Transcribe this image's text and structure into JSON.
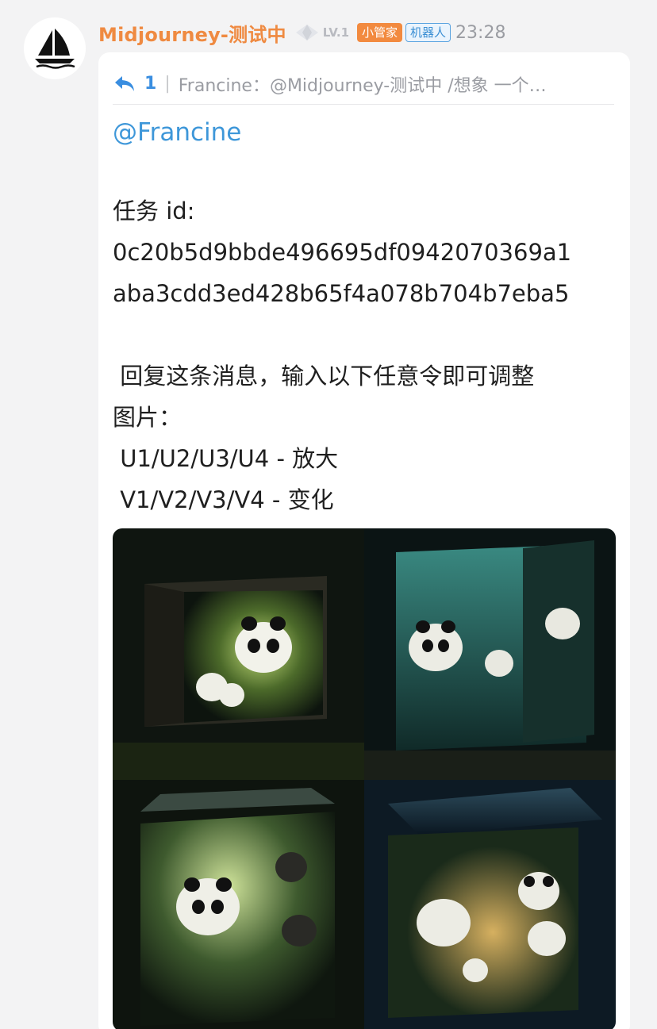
{
  "sender": {
    "name": "Midjourney-测试中",
    "level": "LV.1",
    "badges": {
      "admin": "小管家",
      "bot": "机器人"
    },
    "time": "23:28"
  },
  "quote": {
    "count": "1",
    "text": "Francine：@Midjourney-测试中 /想象  一个…"
  },
  "message": {
    "mention": "@Francine",
    "task_label": "任务 id:",
    "task_id_line1": "0c20b5d9bbde496695df0942070369a1",
    "task_id_line2": "aba3cdd3ed428b65f4a078b704b7eba5",
    "instruction_line1": " 回复这条消息，输入以下任意令即可调整",
    "instruction_line2": "图片：",
    "option_upscale": " U1/U2/U3/U4 - 放大",
    "option_variation": " V1/V2/V3/V4 - 变化"
  },
  "image_grid": {
    "icon": "panda-box-image",
    "tiles": [
      "panda-box-1",
      "panda-box-2",
      "panda-box-3",
      "panda-box-4"
    ]
  }
}
